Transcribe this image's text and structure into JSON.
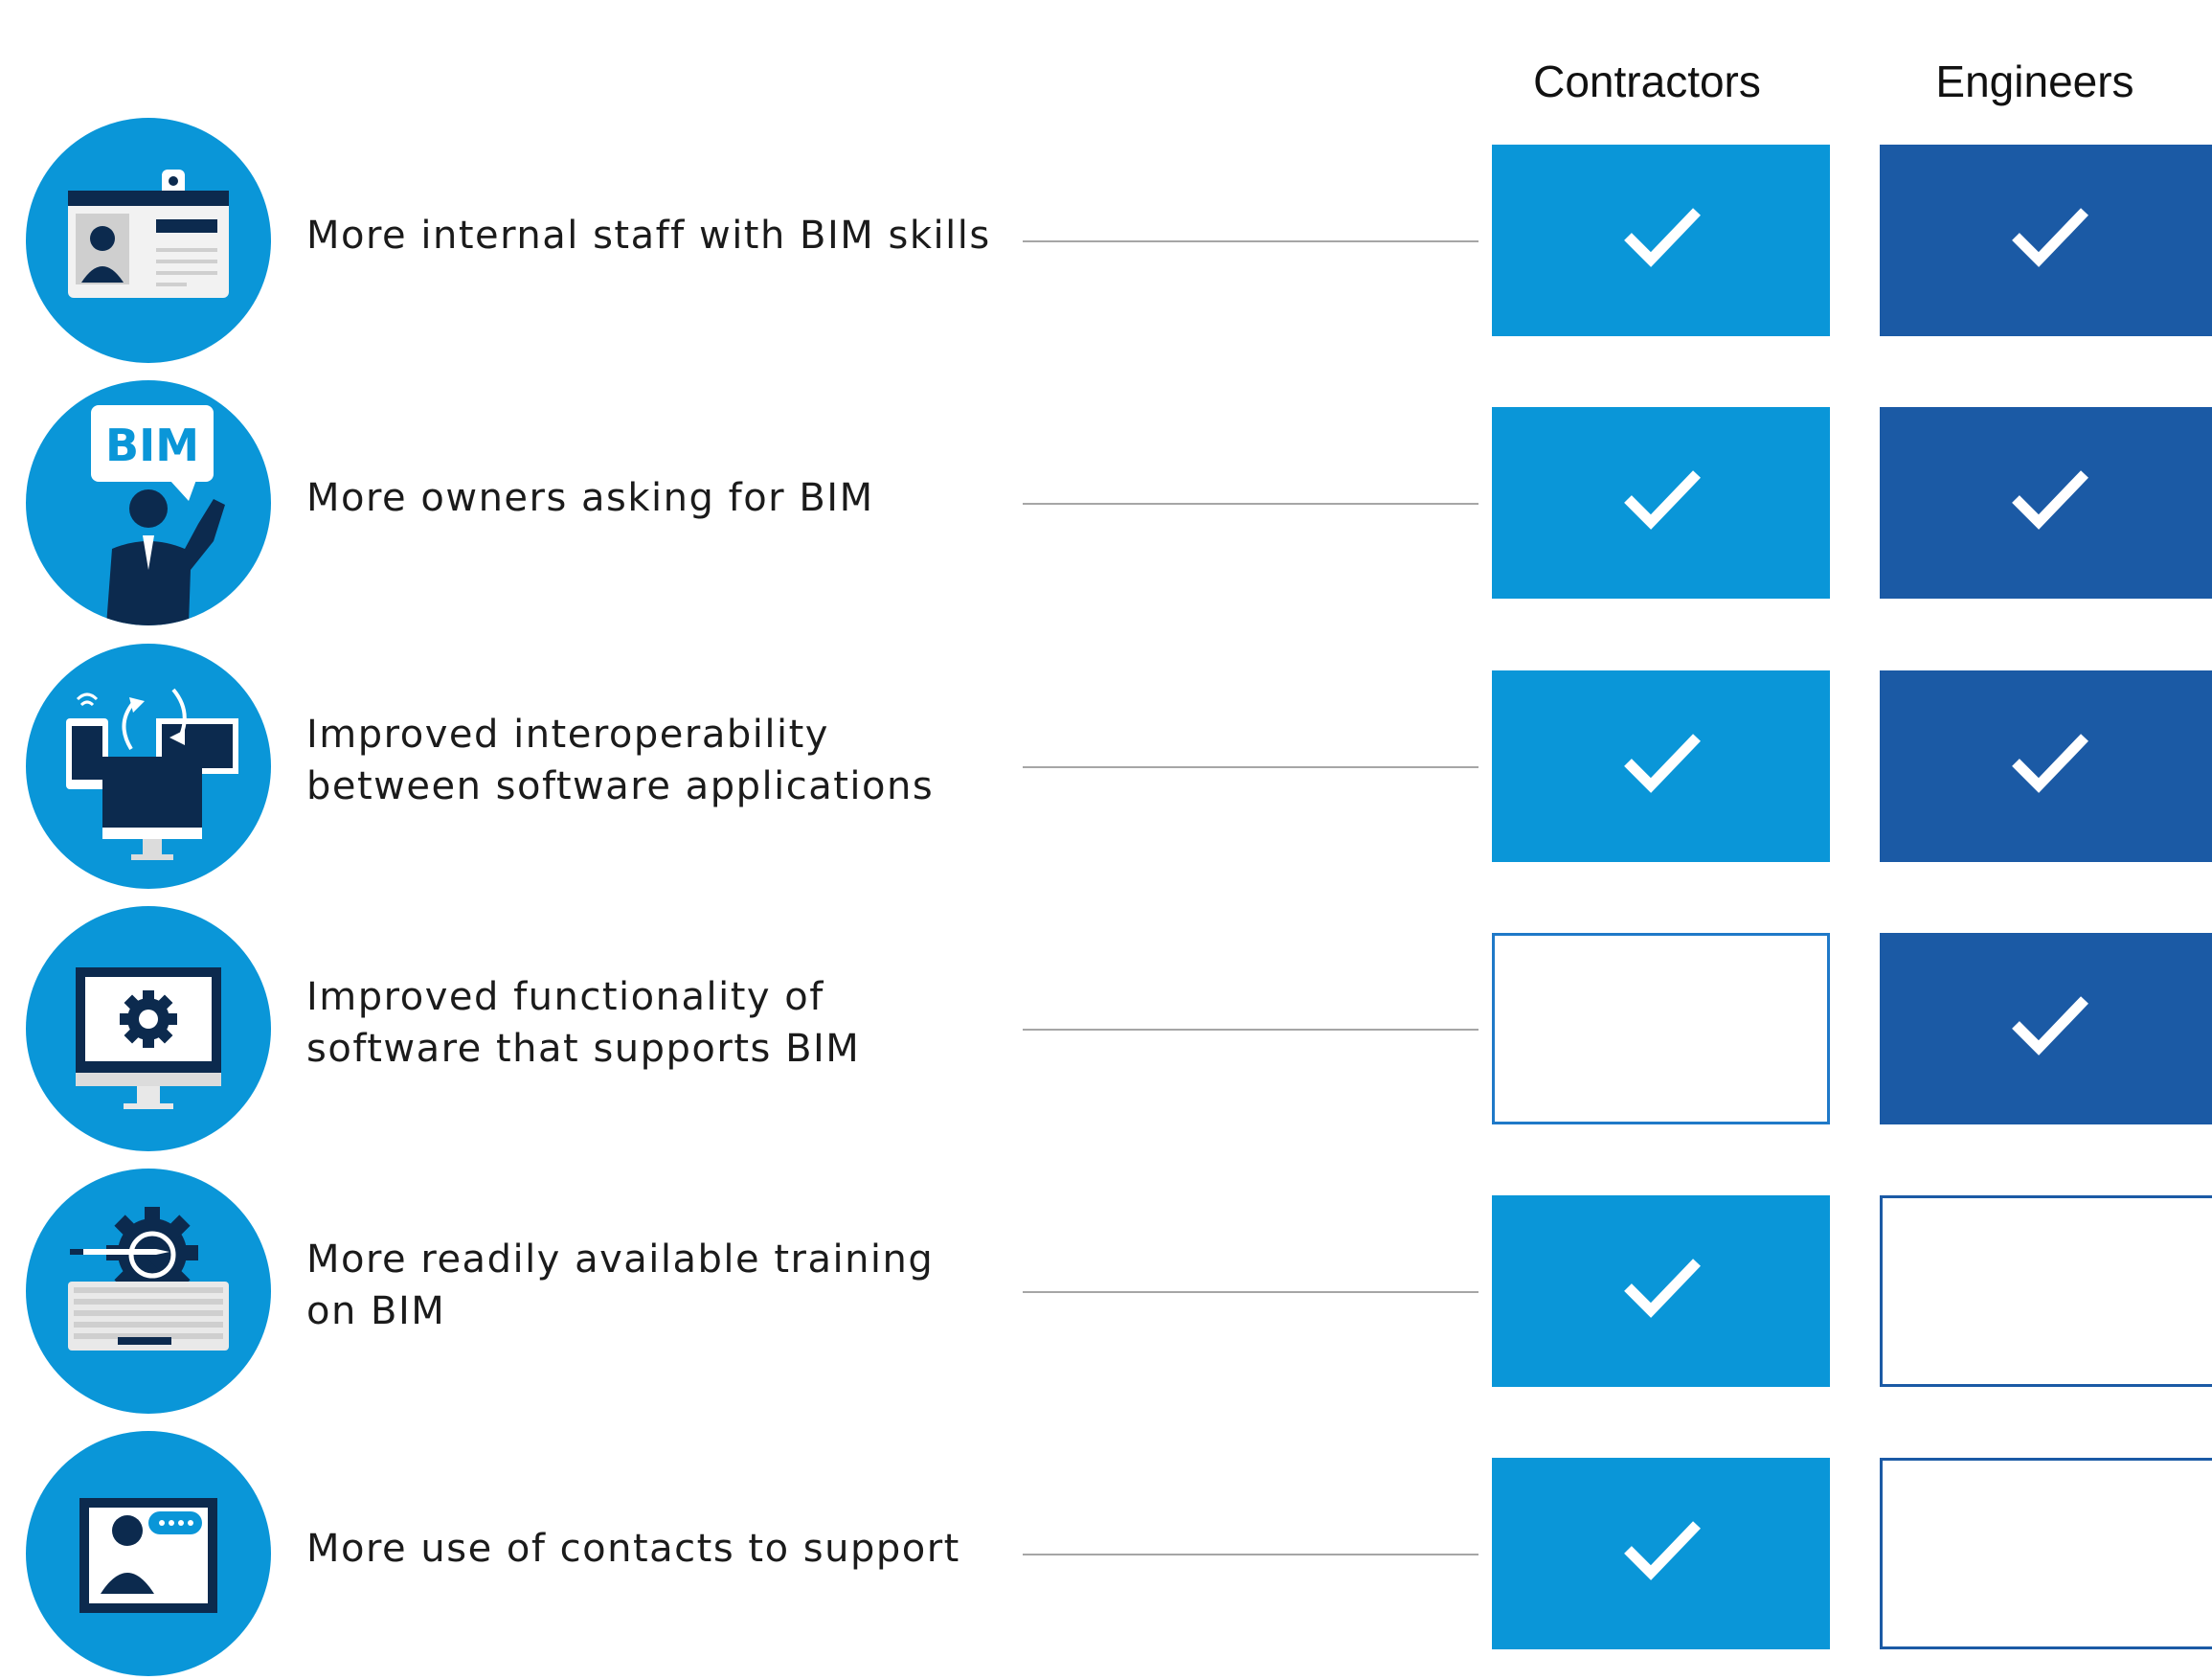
{
  "columns": {
    "contractors": "Contractors",
    "engineers": "Engineers"
  },
  "colors": {
    "icon_bg": "#0a96d8",
    "contractors_fill": "#0a96d8",
    "engineers_fill": "#1b5aa5",
    "empty_border": "#1f79c8",
    "connector": "#a6a6a6",
    "icon_dark": "#0c2a4e"
  },
  "rows": [
    {
      "label": "More internal staff with BIM skills",
      "icon": "id-badge-icon",
      "contractors": true,
      "engineers": true
    },
    {
      "label": "More owners asking for BIM",
      "icon": "bim-speech-person-icon",
      "bim_text": "BIM",
      "contractors": true,
      "engineers": true
    },
    {
      "label": "Improved interoperability between software applications",
      "icon": "devices-sync-icon",
      "contractors": true,
      "engineers": true
    },
    {
      "label": "Improved functionality of software that supports BIM",
      "icon": "monitor-gear-icon",
      "contractors": false,
      "engineers": true
    },
    {
      "label": "More readily available training on BIM",
      "icon": "keyboard-gear-icon",
      "contractors": true,
      "engineers": false
    },
    {
      "label": "More use of contacts to support",
      "icon": "support-contact-icon",
      "contractors": true,
      "engineers": false
    }
  ]
}
